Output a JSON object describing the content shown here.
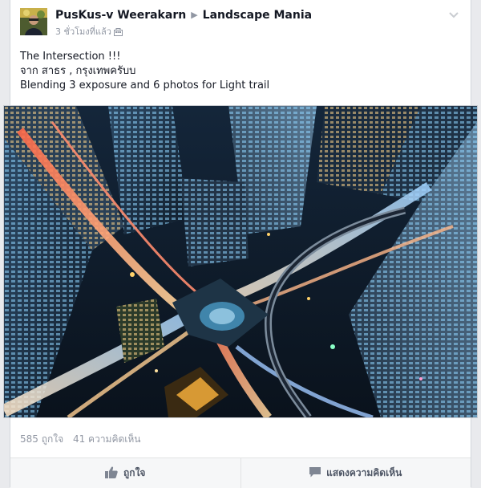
{
  "post": {
    "author": "PusKus-v Weerakarn",
    "group": "Landscape Mania",
    "timestamp": "3 ชั่วโมงที่แล้ว",
    "privacy_icon": "group-privacy-icon",
    "text_lines": [
      "The Intersection !!!",
      "จาก สาธร , กรุงเทพครับบ",
      "Blending 3 exposure and 6 photos for Light trail"
    ],
    "photo_subject": "night-city-intersection-photo"
  },
  "stats": {
    "likes": "585 ถูกใจ",
    "comments": "41 ความคิดเห็น"
  },
  "actions": {
    "like_label": "ถูกใจ",
    "comment_label": "แสดงความคิดเห็น"
  },
  "colors": {
    "name_text": "#141823",
    "meta_text": "#9197a3",
    "action_text": "#4e5665",
    "background": "#e9eaed"
  }
}
